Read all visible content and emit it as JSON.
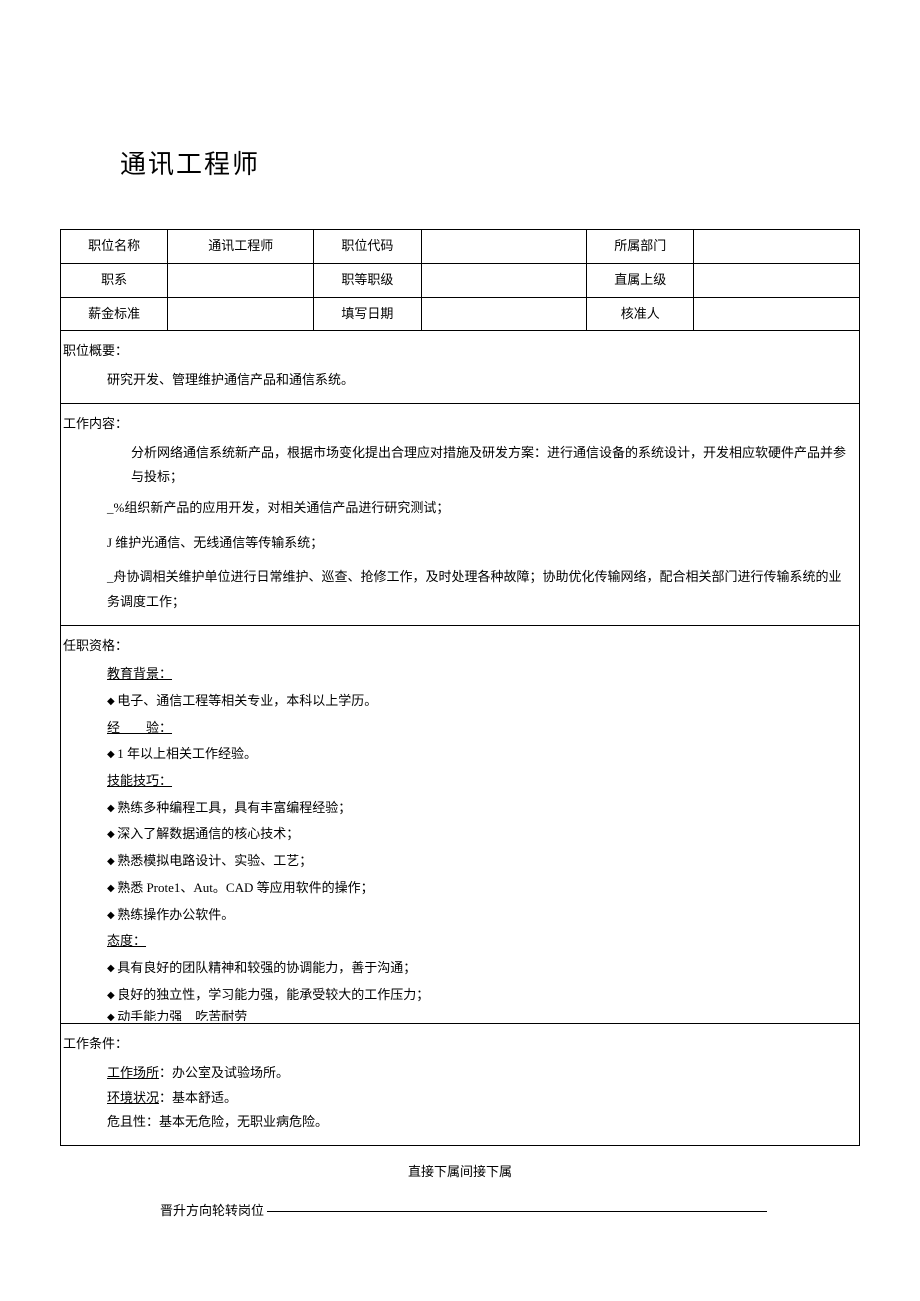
{
  "title": "通讯工程师",
  "headerRows": {
    "r1": {
      "c1": "职位名称",
      "c2": "通讯工程师",
      "c3": "职位代码",
      "c4": "",
      "c5": "所属部门",
      "c6": ""
    },
    "r2": {
      "c1": "职系",
      "c2": "",
      "c3": "职等职级",
      "c4": "",
      "c5": "直属上级",
      "c6": ""
    },
    "r3": {
      "c1": "薪金标准",
      "c2": "",
      "c3": "填写日期",
      "c4": "",
      "c5": "核准人",
      "c6": ""
    }
  },
  "overview": {
    "label": "职位概要：",
    "text": "研究开发、管理维护通信产品和通信系统。"
  },
  "content": {
    "label": "工作内容：",
    "items": [
      "分析网络通信系统新产品，根据市场变化提出合理应对措施及研发方案：进行通信设备的系统设计，开发相应软硬件产品并参与投标；",
      "_%组织新产品的应用开发，对相关通信产品进行研究测试；",
      "J 维护光通信、无线通信等传输系统；",
      "_舟协调相关维护单位进行日常维护、巡查、抢修工作，及时处理各种故障；协助优化传输网络，配合相关部门进行传输系统的业务调度工作；"
    ]
  },
  "qualifications": {
    "label": "任职资格：",
    "edu": {
      "head": "教育背景：",
      "item": "电子、通信工程等相关专业，本科以上学历。"
    },
    "exp": {
      "head": "经　　验：",
      "item": "1 年以上相关工作经验。"
    },
    "skill": {
      "head": "技能技巧：",
      "items": [
        "熟练多种编程工具，具有丰富编程经验；",
        "深入了解数据通信的核心技术；",
        "熟悉模拟电路设计、实验、工艺；",
        "熟悉 Prote1、Aut。CAD 等应用软件的操作；",
        "熟练操作办公软件。"
      ]
    },
    "attitude": {
      "head": "态度：",
      "items": [
        "具有良好的团队精神和较强的协调能力，善于沟通；",
        "良好的独立性，学习能力强，能承受较大的工作压力；",
        "动手能力强　吃苦耐劳"
      ]
    }
  },
  "conditions": {
    "label": "工作条件：",
    "place": {
      "head": "工作场所",
      "sep": "：",
      "text": "办公室及试验场所。"
    },
    "env": {
      "head": "环境状况",
      "sep": "：",
      "text": "基本舒适。"
    },
    "risk": {
      "head": "危且性",
      "sep": "：",
      "text": "基本无危险，无职业病危险。"
    }
  },
  "footer1": "直接下属间接下属",
  "footer2": "晋升方向轮转岗位"
}
